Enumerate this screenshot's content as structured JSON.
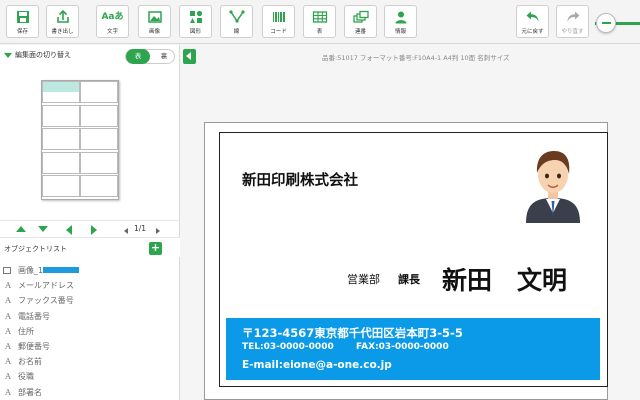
{
  "toolbar": {
    "buttons": [
      {
        "label": "保存",
        "icon": "save-icon"
      },
      {
        "label": "書き出し",
        "icon": "export-icon"
      },
      {
        "label": "文字",
        "icon": "text-icon",
        "glyph": "Aaあ"
      },
      {
        "label": "画像",
        "icon": "image-icon"
      },
      {
        "label": "図形",
        "icon": "shapes-icon"
      },
      {
        "label": "線",
        "icon": "line-icon"
      },
      {
        "label": "コード",
        "icon": "barcode-icon"
      },
      {
        "label": "表",
        "icon": "table-icon"
      },
      {
        "label": "連番",
        "icon": "serial-number-icon"
      },
      {
        "label": "情報",
        "icon": "info-person-icon"
      },
      {
        "label": "元に戻す",
        "icon": "undo-icon"
      },
      {
        "label": "やり直す",
        "icon": "redo-icon"
      }
    ],
    "accent": "#2ea44f"
  },
  "left_panel": {
    "edit_toggle_title": "編集面の切り替え",
    "side_front": "表",
    "side_back": "裏",
    "page_count": "1/1",
    "object_list_title": "オブジェクトリスト",
    "add_label": "+",
    "objects": [
      {
        "type": "image",
        "label": "画像_1"
      },
      {
        "type": "text",
        "glyph": "A",
        "label": "メールアドレス"
      },
      {
        "type": "text",
        "glyph": "A",
        "label": "ファックス番号"
      },
      {
        "type": "text",
        "glyph": "A",
        "label": "電話番号"
      },
      {
        "type": "text",
        "glyph": "A",
        "label": "住所"
      },
      {
        "type": "text",
        "glyph": "A",
        "label": "郵便番号"
      },
      {
        "type": "text",
        "glyph": "A",
        "label": "お名前"
      },
      {
        "type": "text",
        "glyph": "A",
        "label": "役職"
      },
      {
        "type": "text",
        "glyph": "A",
        "label": "部署名"
      }
    ]
  },
  "canvas": {
    "info_line": "品番:51017 フォーマット番号:F10A4-1 A4判 10面 名刺サイズ",
    "card": {
      "company": "新田印刷株式会社",
      "department": "営業部",
      "title": "課長",
      "name": "新田　文明",
      "address": "〒123-4567東京都千代田区岩本町3-5-5",
      "tel": "TEL:03-0000-0000",
      "fax": "FAX:03-0000-0000",
      "email": "E-mail:eione@a-one.co.jp",
      "band_color": "#0a9ae8"
    }
  }
}
